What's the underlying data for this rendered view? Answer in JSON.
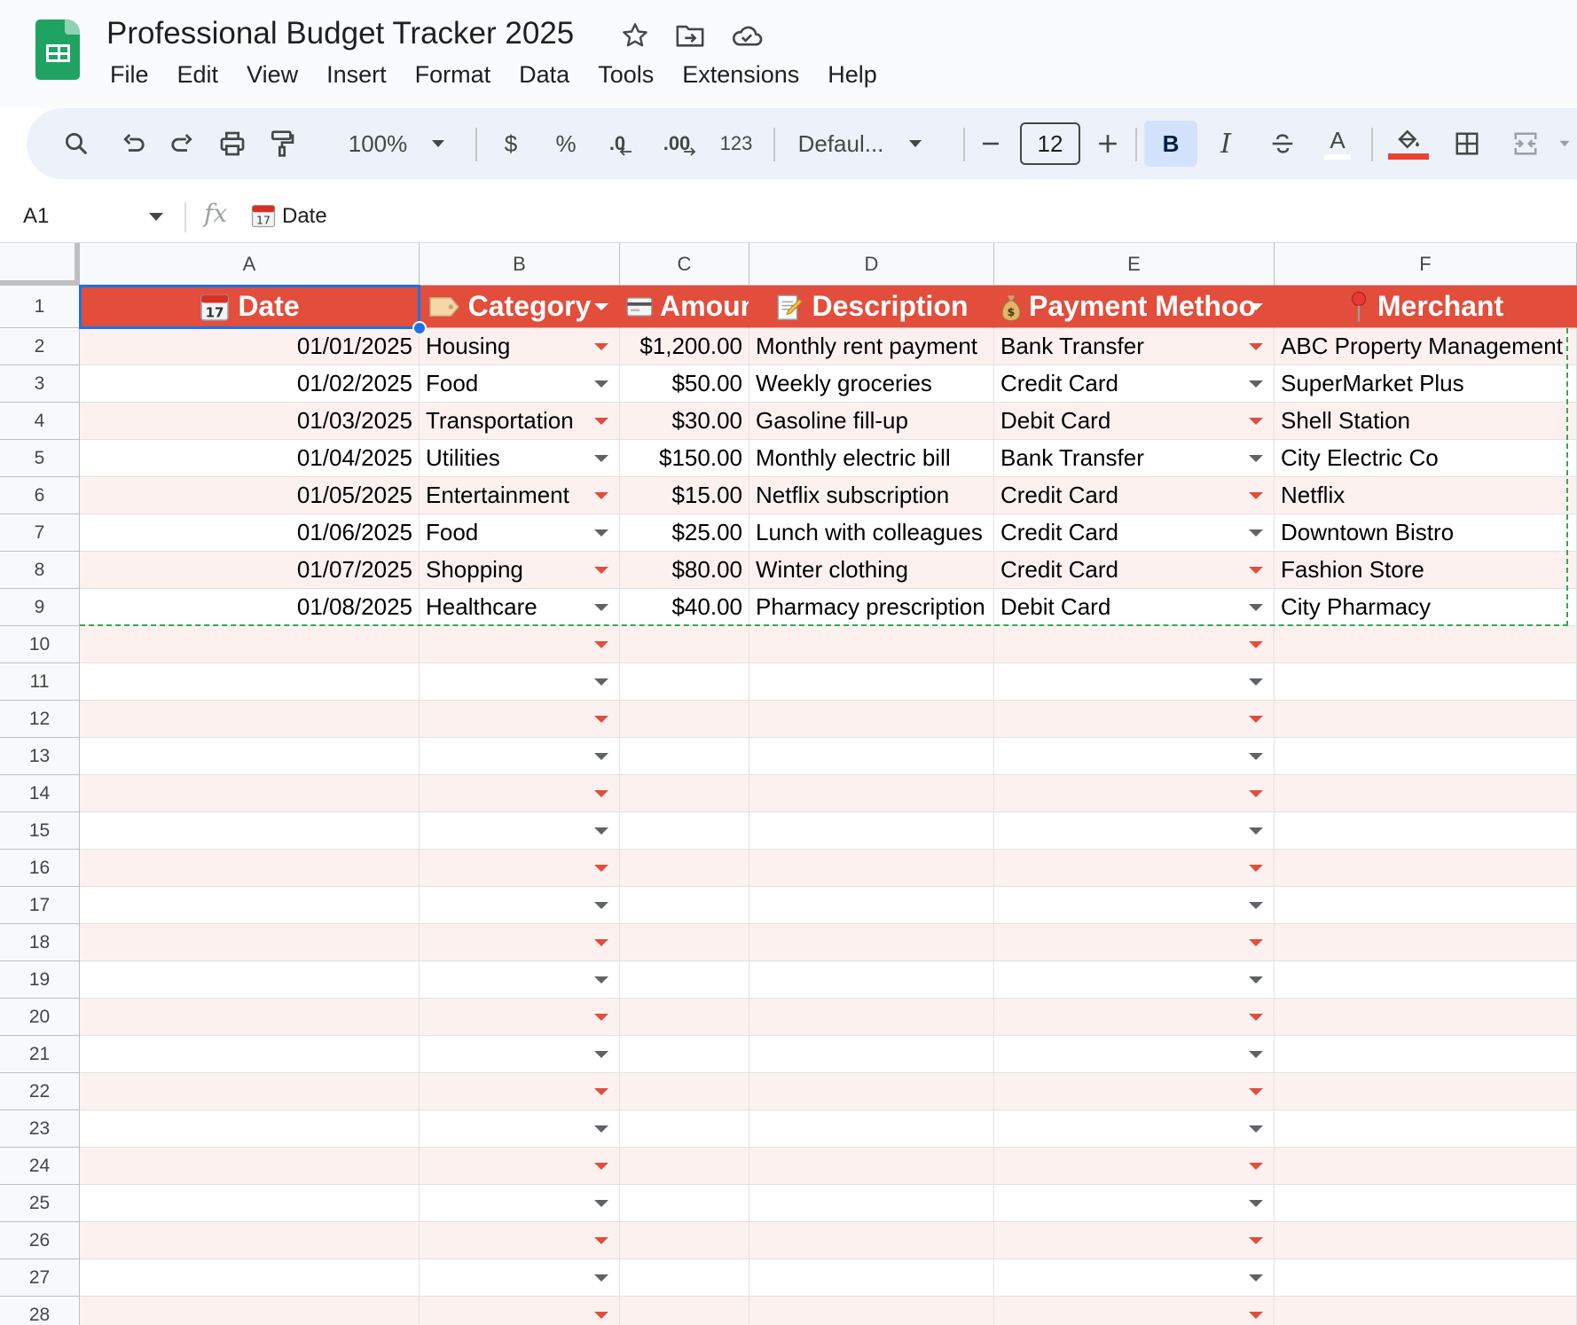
{
  "app": {
    "title": "Professional Budget Tracker 2025",
    "menu": [
      "File",
      "Edit",
      "View",
      "Insert",
      "Format",
      "Data",
      "Tools",
      "Extensions",
      "Help"
    ]
  },
  "toolbar": {
    "zoom": "100%",
    "currency": "$",
    "percent": "%",
    "decrease_decimal": ".0",
    "increase_decimal": ".00",
    "number_format": "123",
    "font": "Defaul...",
    "font_size": "12",
    "bold": "B",
    "italic": "I",
    "text_color_letter": "A",
    "fill_color": "#ea4335"
  },
  "formula_bar": {
    "cell_ref": "A1",
    "fx": "fx",
    "content": "Date"
  },
  "grid": {
    "columns": [
      "A",
      "B",
      "C",
      "D",
      "E",
      "F"
    ],
    "rows": [
      "1",
      "2",
      "3",
      "4",
      "5",
      "6",
      "7",
      "8",
      "9",
      "10",
      "11",
      "12",
      "13",
      "14",
      "15",
      "16",
      "17",
      "18",
      "19",
      "20",
      "21",
      "22",
      "23",
      "24",
      "25",
      "26",
      "27",
      "28"
    ],
    "headers": [
      {
        "label": "Date",
        "icon": "calendar-icon"
      },
      {
        "label": "Category",
        "icon": "tag-icon"
      },
      {
        "label": "Amoun",
        "icon": "credit-card-icon"
      },
      {
        "label": "Description",
        "icon": "memo-icon"
      },
      {
        "label": "Payment Methoo",
        "icon": "money-bag-icon"
      },
      {
        "label": "Merchant",
        "icon": "pin-icon"
      }
    ],
    "data": [
      [
        "01/01/2025",
        "Housing",
        "$1,200.00",
        "Monthly rent payment",
        "Bank Transfer",
        "ABC Property Management"
      ],
      [
        "01/02/2025",
        "Food",
        "$50.00",
        "Weekly groceries",
        "Credit Card",
        "SuperMarket Plus"
      ],
      [
        "01/03/2025",
        "Transportation",
        "$30.00",
        "Gasoline fill-up",
        "Debit Card",
        "Shell Station"
      ],
      [
        "01/04/2025",
        "Utilities",
        "$150.00",
        "Monthly electric bill",
        "Bank Transfer",
        "City Electric Co"
      ],
      [
        "01/05/2025",
        "Entertainment",
        "$15.00",
        "Netflix subscription",
        "Credit Card",
        "Netflix"
      ],
      [
        "01/06/2025",
        "Food",
        "$25.00",
        "Lunch with colleagues",
        "Credit Card",
        "Downtown Bistro"
      ],
      [
        "01/07/2025",
        "Shopping",
        "$80.00",
        "Winter clothing",
        "Credit Card",
        "Fashion Store"
      ],
      [
        "01/08/2025",
        "Healthcare",
        "$40.00",
        "Pharmacy prescription",
        "Debit Card",
        "City Pharmacy"
      ]
    ],
    "colors": {
      "header_bg": "#e24d3c",
      "band_bg": "#fdf1f0",
      "dropdown_red": "#e24d3c",
      "dropdown_grey": "#5f6368",
      "selection": "#1a73e8"
    }
  }
}
